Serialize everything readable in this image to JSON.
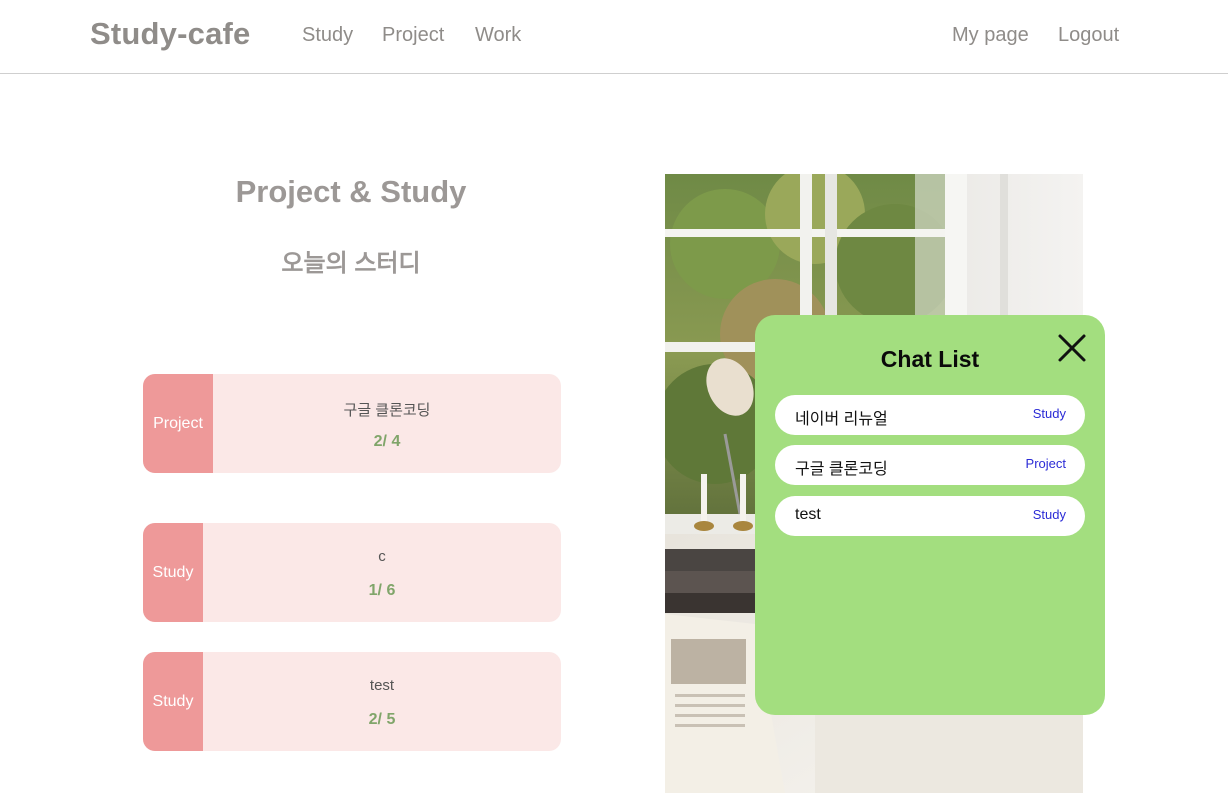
{
  "header": {
    "logo": "Study-cafe",
    "nav": [
      "Study",
      "Project",
      "Work"
    ],
    "my_page": "My page",
    "logout": "Logout"
  },
  "main": {
    "title": "Project & Study",
    "subtitle": "오늘의 스터디",
    "cards": [
      {
        "tag": "Project",
        "title": "구글 클론코딩",
        "count": "2/ 4"
      },
      {
        "tag": "Study",
        "title": "c",
        "count": "1/ 6"
      },
      {
        "tag": "Study",
        "title": "test",
        "count": "2/ 5"
      }
    ]
  },
  "chat": {
    "title": "Chat List",
    "items": [
      {
        "name": "네이버 리뉴얼",
        "type": "Study"
      },
      {
        "name": "구글 클론코딩",
        "type": "Project"
      },
      {
        "name": "test",
        "type": "Study"
      }
    ]
  },
  "colors": {
    "accent_pink": "#ee9999",
    "card_bg": "#fbe8e7",
    "count_green": "#80a56a",
    "chat_green": "#a3de7f",
    "chat_type_blue": "#2b2bd6"
  }
}
